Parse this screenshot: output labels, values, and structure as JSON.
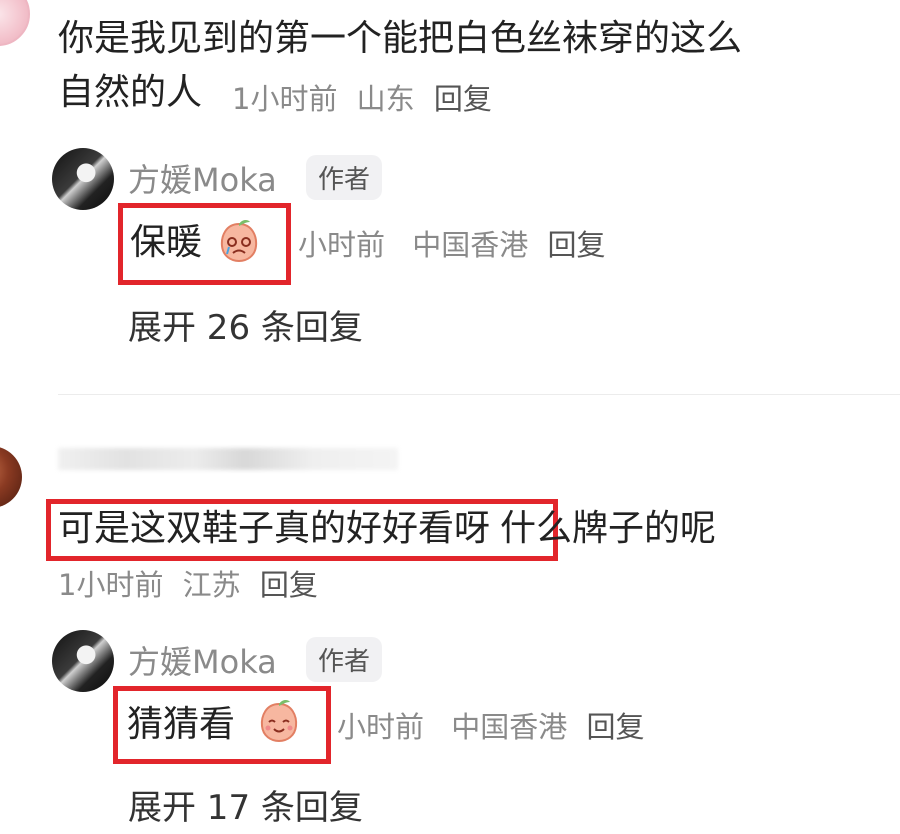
{
  "comment1": {
    "line1": "你是我见到的第一个能把白色丝袜穿的这么",
    "line2": "自然的人",
    "time": "1小时前",
    "location": "山东",
    "reply": "回复"
  },
  "reply1": {
    "author": "方媛Moka",
    "tag": "作者",
    "text": "保暖",
    "time": "小时前",
    "location": "中国香港",
    "reply": "回复",
    "expand": "展开 26 条回复"
  },
  "comment2": {
    "text_boxed": "可是这双鞋子真的好好看呀",
    "text_rest": "什么牌子的呢",
    "time": "1小时前",
    "location": "江苏",
    "reply": "回复"
  },
  "reply2": {
    "author": "方媛Moka",
    "tag": "作者",
    "text": "猜猜看",
    "time": "小时前",
    "location": "中国香港",
    "reply": "回复",
    "expand": "展开 17 条回复"
  },
  "icons": {
    "emoji1": "peach-cry-emoji",
    "emoji2": "peach-smile-emoji"
  },
  "colors": {
    "highlight_box": "#e2252b",
    "meta_text": "#8a8a8a"
  }
}
